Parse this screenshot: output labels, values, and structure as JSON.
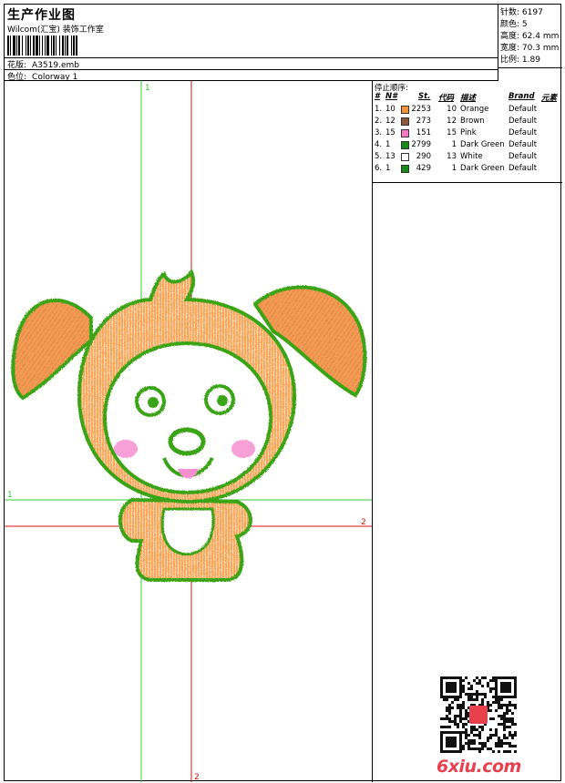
{
  "header": {
    "title": "生产作业图",
    "subtitle": "Wilcom(汇宝) 装饰工作室",
    "design_label": "花版:",
    "design_value": "A3519.emb",
    "colorway_label": "色位:",
    "colorway_value": "Colorway 1"
  },
  "stats": [
    {
      "label": "针数:",
      "value": "6197"
    },
    {
      "label": "颜色:",
      "value": "5"
    },
    {
      "label": "高度:",
      "value": "62.4 mm"
    },
    {
      "label": "宽度:",
      "value": "70.3 mm"
    },
    {
      "label": "比例:",
      "value": "1.89"
    }
  ],
  "canvas": {
    "green_v_label": "1",
    "green_h_label": "1",
    "red_h_label": "2",
    "red_v_label": "2"
  },
  "stop_order": {
    "title": "停止顺序:",
    "headers": {
      "num": "#",
      "n": "N#",
      "st": "St.",
      "code": "代码",
      "desc": "描述",
      "brand": "Brand",
      "elem": "元素"
    },
    "rows": [
      {
        "num": "1.",
        "n": "10",
        "color": "#f7943a",
        "st": "2253",
        "code": "10",
        "desc": "Orange",
        "brand": "Default"
      },
      {
        "num": "2.",
        "n": "12",
        "color": "#8b5a3c",
        "st": "273",
        "code": "12",
        "desc": "Brown",
        "brand": "Default"
      },
      {
        "num": "3.",
        "n": "15",
        "color": "#f47ac4",
        "st": "151",
        "code": "15",
        "desc": "Pink",
        "brand": "Default"
      },
      {
        "num": "4.",
        "n": "1",
        "color": "#1a8a1a",
        "st": "2799",
        "code": "1",
        "desc": "Dark Green",
        "brand": "Default"
      },
      {
        "num": "5.",
        "n": "13",
        "color": "#ffffff",
        "st": "290",
        "code": "13",
        "desc": "White",
        "brand": "Default"
      },
      {
        "num": "6.",
        "n": "1",
        "color": "#1a8a1a",
        "st": "429",
        "code": "1",
        "desc": "Dark Green",
        "brand": "Default"
      }
    ]
  },
  "logo": {
    "text": "6xiu.com",
    "color": "#e8414d"
  },
  "colors": {
    "orange_fill": "#f7a75a",
    "green_outline": "#3aa314",
    "pink_cheek": "#f58fd0",
    "guide_green": "#33cc33",
    "guide_red": "#e01010"
  }
}
